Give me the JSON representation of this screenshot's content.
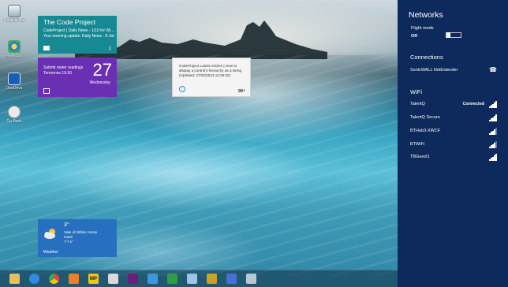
{
  "desktop_icons": [
    {
      "label": "Recycle Bin",
      "icon": "recycle-bin-icon"
    },
    {
      "label": "Reflector",
      "icon": "reflector-icon"
    },
    {
      "label": "OneDrive",
      "icon": "drive-icon"
    },
    {
      "label": "Go Back",
      "icon": "back-icon"
    }
  ],
  "tiles": {
    "codeproject": {
      "title": "The Code Project",
      "line1": "CodeProject | Daily News - 1/10 for Wi...",
      "line2": "Your morning update: Daily News - 8 Jan...",
      "count": "1"
    },
    "calendar": {
      "event1": "Submit meter readings",
      "event2": "Tomorrow 19:30",
      "day": "27",
      "weekday": "Wednesday"
    },
    "articles": {
      "text": "CodeProject Latest Articles | How to display a control's hierarchy as a string (Updated: 27/02/2013 13:26:32)",
      "count": "99⁺"
    },
    "weather": {
      "temp": "3°",
      "location": "Vale of White Horse",
      "condition": "Haze",
      "range": "7°/-1°",
      "name": "Weather"
    }
  },
  "taskbar": {
    "items": [
      {
        "name": "file-explorer-icon",
        "color": "#e8c05a"
      },
      {
        "name": "internet-explorer-icon",
        "color": "#2d8de0"
      },
      {
        "name": "chrome-icon",
        "color": "#e04a3c"
      },
      {
        "name": "media-player-icon",
        "color": "#e8802a"
      },
      {
        "name": "mp-app-icon",
        "color": "#f0c419",
        "label": "MP"
      },
      {
        "name": "notepad-icon",
        "color": "#dadada"
      },
      {
        "name": "visual-studio-icon",
        "color": "#68217a"
      },
      {
        "name": "remote-desktop-icon",
        "color": "#3a9ad9"
      },
      {
        "name": "checkmark-app-icon",
        "color": "#2f9e44"
      },
      {
        "name": "network-app-icon",
        "color": "#9cc6e8"
      },
      {
        "name": "signal-app-icon",
        "color": "#c9a227"
      },
      {
        "name": "paint-icon",
        "color": "#4a6fd8"
      },
      {
        "name": "window-app-icon",
        "color": "#b9c7d2"
      }
    ]
  },
  "networks_pane": {
    "title": "Networks",
    "flight_mode_label": "Flight mode",
    "flight_mode_state": "Off",
    "connections_heading": "Connections",
    "connections": [
      {
        "name": "SonicWALL NetExtender",
        "icon": "phone-icon"
      }
    ],
    "wifi_heading": "WiFi",
    "wifi_networks": [
      {
        "name": "TalentQ",
        "status": "Connected",
        "bars": 5
      },
      {
        "name": "TalentQ Secure",
        "status": "",
        "bars": 5
      },
      {
        "name": "BTHub3-XWCF",
        "status": "",
        "bars": 4
      },
      {
        "name": "BTWiFi",
        "status": "",
        "bars": 4,
        "shield": true
      },
      {
        "name": "TBGuest1",
        "status": "",
        "bars": 5
      }
    ]
  },
  "colors": {
    "charm_bg": "#0e2a5c",
    "codeproject_tile": "#168993",
    "calendar_tile": "#6b2fb3",
    "weather_tile": "#2670bf"
  }
}
